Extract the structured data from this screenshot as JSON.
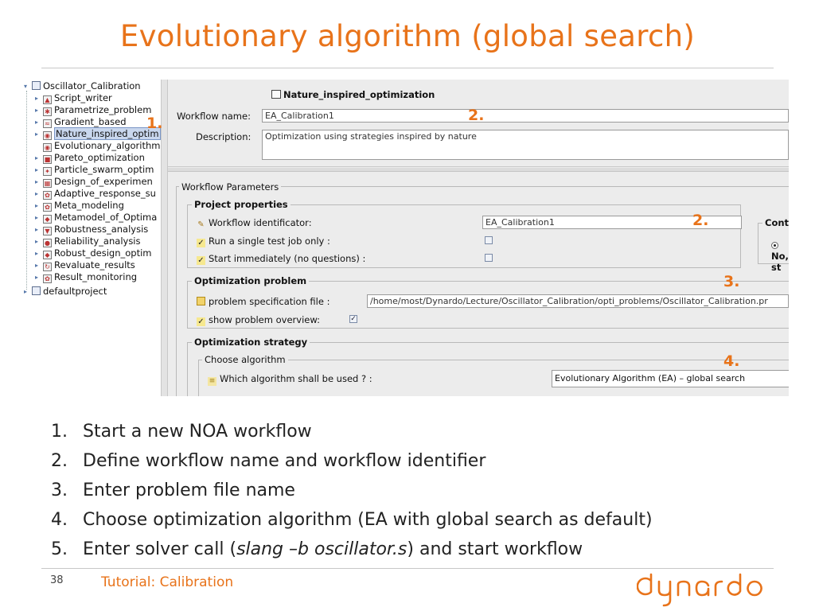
{
  "title": "Evolutionary algorithm (global search)",
  "tree": {
    "root": "Oscillator_Calibration",
    "items": [
      {
        "label": "Script_writer",
        "icon": "script-icon"
      },
      {
        "label": "Parametrize_problem",
        "icon": "parametrize-icon"
      },
      {
        "label": "Gradient_based",
        "icon": "gradient-icon"
      },
      {
        "label": "Nature_inspired_optim",
        "icon": "nature-icon",
        "selected": true
      },
      {
        "label": "Evolutionary_algorithm",
        "icon": "evolutionary-icon"
      },
      {
        "label": "Pareto_optimization",
        "icon": "pareto-icon"
      },
      {
        "label": "Particle_swarm_optim",
        "icon": "swarm-icon"
      },
      {
        "label": "Design_of_experimen",
        "icon": "doe-icon"
      },
      {
        "label": "Adaptive_response_su",
        "icon": "adaptive-icon"
      },
      {
        "label": "Meta_modeling",
        "icon": "meta-icon"
      },
      {
        "label": "Metamodel_of_Optima",
        "icon": "mop-icon"
      },
      {
        "label": "Robustness_analysis",
        "icon": "robustness-icon"
      },
      {
        "label": "Reliability_analysis",
        "icon": "reliability-icon"
      },
      {
        "label": "Robust_design_optim",
        "icon": "robust-design-icon"
      },
      {
        "label": "Revaluate_results",
        "icon": "revaluate-icon"
      },
      {
        "label": "Result_monitoring",
        "icon": "monitor-icon"
      }
    ],
    "second_root": "defaultproject"
  },
  "form": {
    "header": "Nature_inspired_optimization",
    "workflow_name_label": "Workflow name:",
    "workflow_name_value": "EA_Calibration1",
    "description_label": "Description:",
    "description_value": "Optimization using strategies inspired by nature",
    "workflow_parameters": "Workflow Parameters",
    "project_properties": "Project properties",
    "workflow_identificator_label": "Workflow identificator:",
    "workflow_identificator_value": "EA_Calibration1",
    "single_test_label": "Run a single test job only :",
    "single_test_checked": false,
    "start_immediately_label": "Start immediately (no questions) :",
    "start_immediately_checked": false,
    "continue_group": "Continue",
    "continue_option": "No, st",
    "optimization_problem": "Optimization problem",
    "problem_file_label": "problem specification file :",
    "problem_file_value": "/home/most/Dynardo/Lecture/Oscillator_Calibration/opti_problems/Oscillator_Calibration.pr",
    "show_overview_label": "show problem overview:",
    "show_overview_checked": true,
    "optimization_strategy": "Optimization strategy",
    "choose_algorithm": "Choose algorithm",
    "which_algorithm_label": "Which algorithm shall be used ? :",
    "algorithm_value": "Evolutionary Algorithm (EA) – global search"
  },
  "callouts": {
    "c1": "1.",
    "c2a": "2.",
    "c2b": "2.",
    "c3": "3.",
    "c4": "4."
  },
  "steps": [
    {
      "num": "1.",
      "text": "Start a new NOA workflow"
    },
    {
      "num": "2.",
      "text": "Define workflow name and workflow identifier"
    },
    {
      "num": "3.",
      "text": "Enter problem file name"
    },
    {
      "num": "4.",
      "text": "Choose optimization algorithm (EA with global search as default)"
    },
    {
      "num": "5.",
      "pre": "Enter solver call (",
      "em": "slang –b oscillator.s",
      "post": ") and start workflow"
    }
  ],
  "footer": {
    "page": "38",
    "text": "Tutorial: Calibration",
    "logo": "dynardo"
  },
  "colors": {
    "accent": "#e8731a",
    "selection": "#c9d7ee",
    "panel": "#ececec"
  }
}
